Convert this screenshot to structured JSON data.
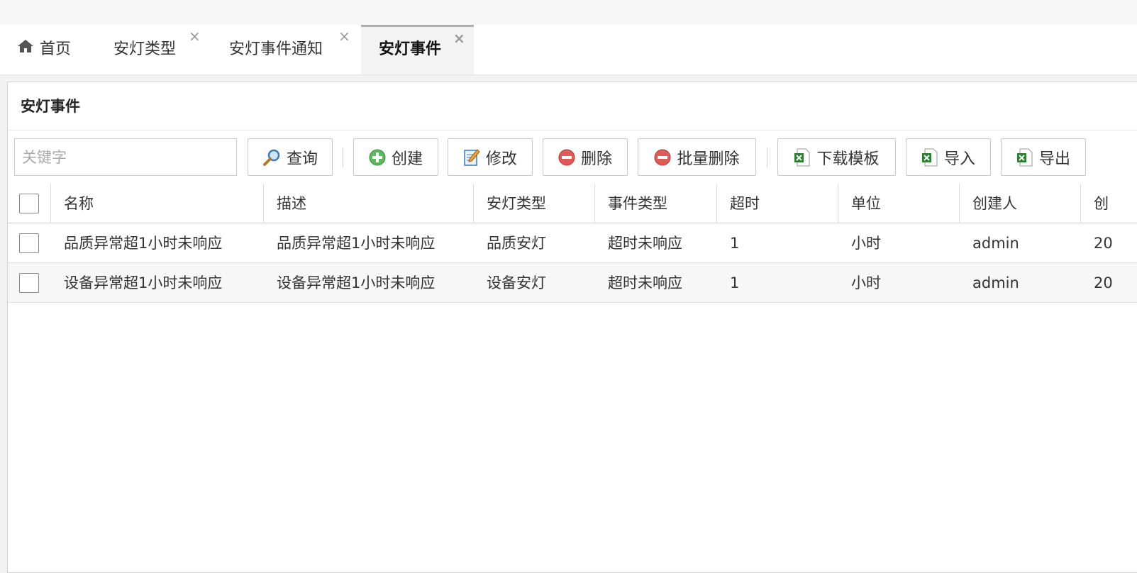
{
  "tabs": [
    {
      "label": "首页",
      "icon": "home-icon",
      "closable": false,
      "active": false
    },
    {
      "label": "安灯类型",
      "closable": true,
      "active": false
    },
    {
      "label": "安灯事件通知",
      "closable": true,
      "active": false
    },
    {
      "label": "安灯事件",
      "closable": true,
      "active": true
    }
  ],
  "close_glyph": "×",
  "panel": {
    "title": "安灯事件"
  },
  "toolbar": {
    "search_placeholder": "关键字",
    "query": "查询",
    "create": "创建",
    "edit": "修改",
    "delete": "删除",
    "batch_delete": "批量删除",
    "download_template": "下载模板",
    "import": "导入",
    "export": "导出"
  },
  "table": {
    "columns": [
      "名称",
      "描述",
      "安灯类型",
      "事件类型",
      "超时",
      "单位",
      "创建人",
      "创"
    ],
    "rows": [
      [
        "品质异常超1小时未响应",
        "品质异常超1小时未响应",
        "品质安灯",
        "超时未响应",
        "1",
        "小时",
        "admin",
        "20"
      ],
      [
        "设备异常超1小时未响应",
        "设备异常超1小时未响应",
        "设备安灯",
        "超时未响应",
        "1",
        "小时",
        "admin",
        "20"
      ]
    ]
  },
  "colors": {
    "accent_green": "#5cb85c",
    "danger_red": "#d9534f",
    "excel_green": "#2e7d32",
    "active_tab_bg": "#f3f3f3"
  }
}
